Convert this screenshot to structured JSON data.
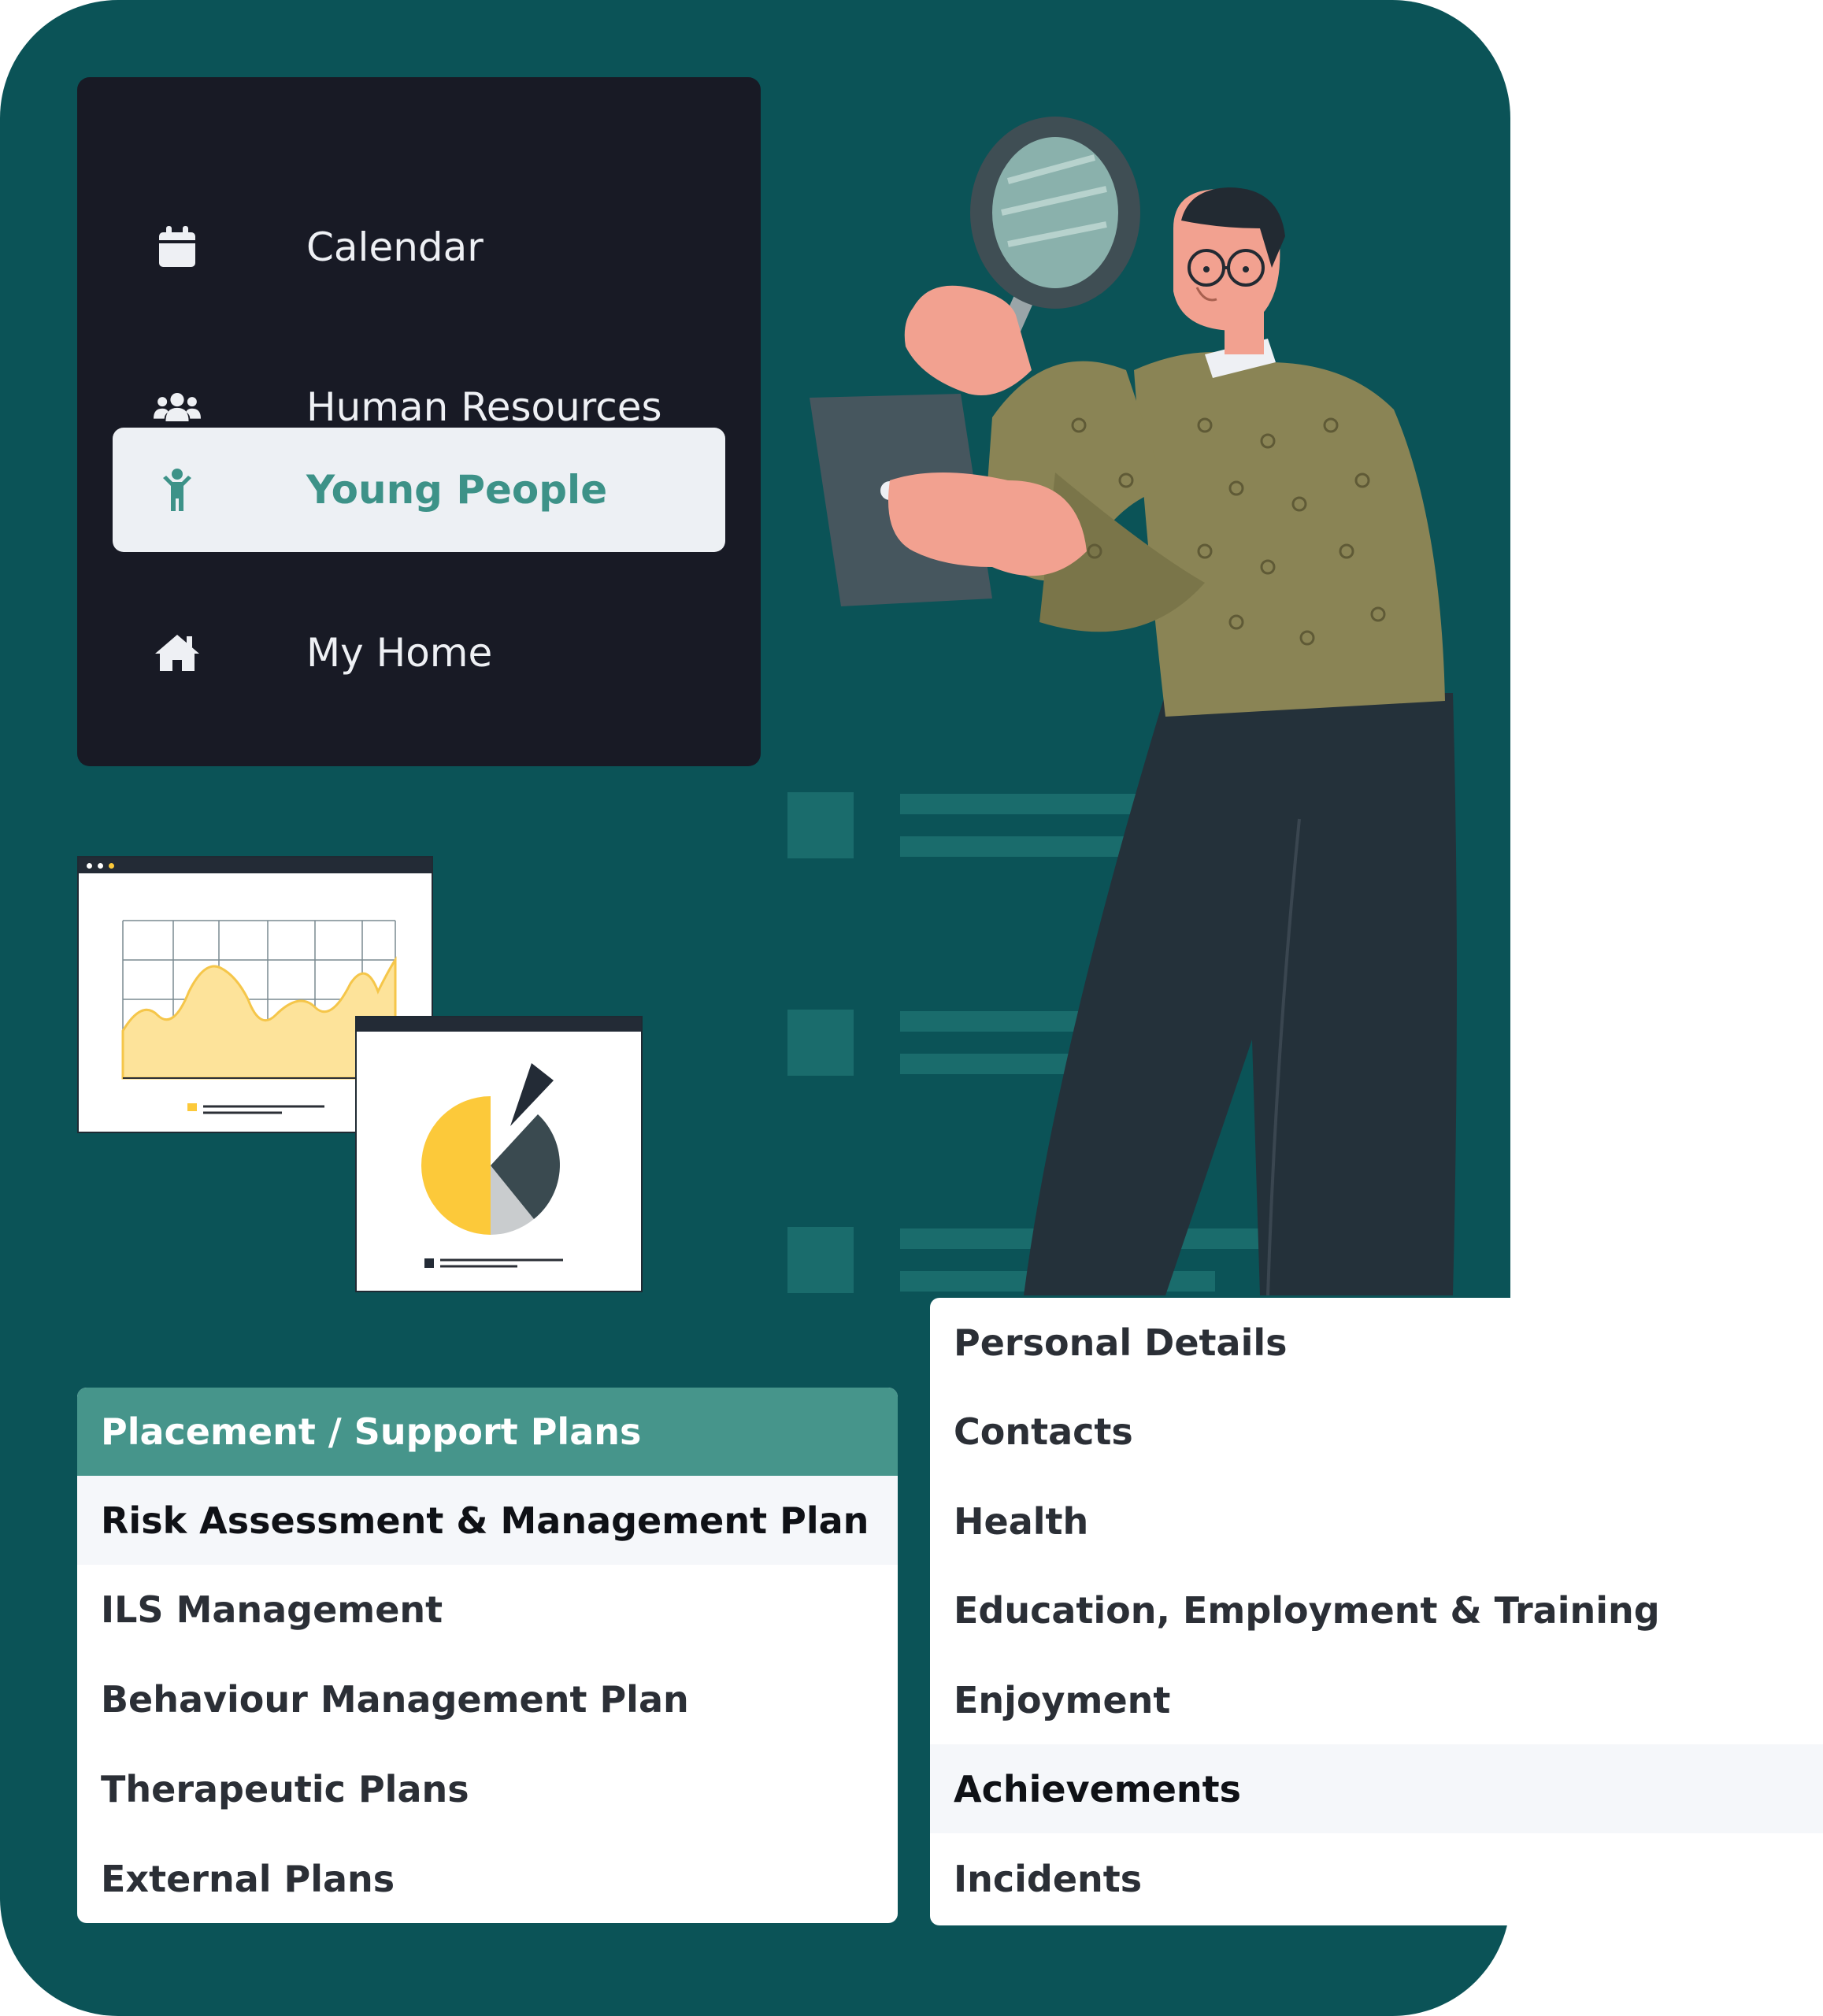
{
  "sidebar": {
    "items": [
      {
        "label": "Calendar",
        "icon": "calendar-icon",
        "active": false
      },
      {
        "label": "Human Resources",
        "icon": "users-icon",
        "active": false
      },
      {
        "label": "Young People",
        "icon": "child-icon",
        "active": true
      },
      {
        "label": "My Home",
        "icon": "home-icon",
        "active": false
      }
    ]
  },
  "plans_card": {
    "header": "Placement / Support Plans",
    "items": [
      "Risk Assessment & Management Plan",
      "ILS Management",
      "Behaviour Management Plan",
      "Therapeutic Plans",
      "External Plans"
    ],
    "highlighted_index": 0
  },
  "profile_menu": {
    "items": [
      "Personal Details",
      "Contacts",
      "Health",
      "Education, Employment & Training",
      "Enjoyment",
      "Achievements",
      "Incidents"
    ],
    "highlighted_index": 5
  },
  "colors": {
    "background": "#0b5357",
    "sidebar": "#181a25",
    "active_accent": "#3d9288",
    "card_header": "#46958b"
  }
}
